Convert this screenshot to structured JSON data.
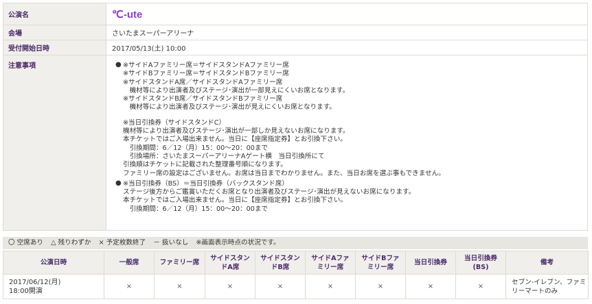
{
  "info": {
    "performance_label": "公演名",
    "performance_name": "℃-ute",
    "venue_label": "会場",
    "venue_value": "さいたまスーパーアリーナ",
    "start_label": "受付開始日時",
    "start_value": "2017/05/13(土) 10:00",
    "notes_label": "注意事項",
    "notes": [
      [
        "※サイドAファミリー席＝サイドスタンドAファミリー席",
        "※サイドBファミリー席＝サイドスタンドBファミリー席",
        "※サイドスタンドA席／サイドスタンドAファミリー席",
        "　機材等により出演者及びステージ･演出が一部見えにくいお席となります。",
        "※サイドスタンドB席／サイドスタンドBファミリー席",
        "　機材等により出演者及びステージ･演出が見えにくいお席となります。",
        "",
        "※当日引換券（サイドスタンドC）",
        "機材等により出演者及びステージ･演出が一部しか見えないお席になります。",
        "本チケットではご入場出来ません。当日に【座席指定券】とお引換下さい。",
        "　引換期間：6／12（月）15：00～20：00まで",
        "　引換場所：さいたまスーパーアリーナAゲート横　当日引換所にて",
        "引換順はチケットに記載された整理番号順になります。",
        "ファミリー席の設定はございません。お席は当日までわかりません。また、当日お席を選ぶ事もできません。"
      ],
      [
        "※当日引換券（BS）＝当日引換券（バックスタンド席）",
        "ステージ後方からご鑑賞いただくお席となり出演者及びステージ･演出が見えないお席になります。",
        "本チケットではご入場出来ません。当日に【座席指定券】とお引換下さい。",
        "　引換期間：6／12（月）15：00～20：00まで"
      ]
    ]
  },
  "legend": {
    "available": "〇 空席あり",
    "few": "△ 残りわずか",
    "sold_out": "× 予定枚数終了",
    "none": "－ 扱いなし",
    "note": "※画面表示時点の状況です。"
  },
  "schedule": {
    "headers": {
      "date": "公演日時",
      "general": "一般席",
      "family": "ファミリー席",
      "side_a_1": "サイドスタン",
      "side_a_2": "ドA席",
      "side_b_1": "サイドスタン",
      "side_b_2": "ドB席",
      "side_a_fam_1": "サイドAファ",
      "side_a_fam_2": "ミリー席",
      "side_b_fam_1": "サイドBファ",
      "side_b_fam_2": "ミリー席",
      "same_day": "当日引換券",
      "same_day_bs_1": "当日引換券",
      "same_day_bs_2": "(BS)",
      "remarks": "備考"
    },
    "row": {
      "date_1": "2017/06/12(月)",
      "date_2": "18:00開演",
      "general": "×",
      "family": "×",
      "side_a": "×",
      "side_b": "×",
      "side_a_fam": "×",
      "side_b_fam": "×",
      "same_day": "×",
      "same_day_bs": "×",
      "remarks_1": "セブン-イレブン、ファミ",
      "remarks_2": "リーマートのみ"
    }
  }
}
